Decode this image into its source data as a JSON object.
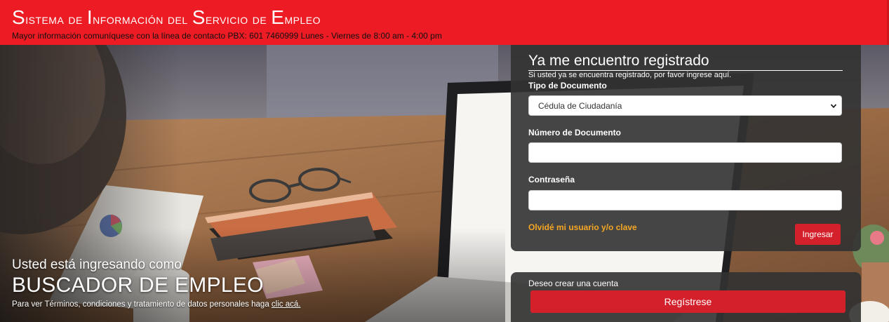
{
  "header": {
    "title_parts": [
      {
        "cap": "S",
        "rest": "istema "
      },
      {
        "cap": "",
        "rest": "de "
      },
      {
        "cap": "I",
        "rest": "nformación "
      },
      {
        "cap": "",
        "rest": "del "
      },
      {
        "cap": "S",
        "rest": "ervicio "
      },
      {
        "cap": "",
        "rest": "de "
      },
      {
        "cap": "E",
        "rest": "mpleo"
      }
    ],
    "contact": "Mayor información comuníquese con la línea de contacto PBX: 601 7460999 Lunes - Viernes de 8:00 am - 4:00 pm",
    "color": "#ed1c24"
  },
  "hero": {
    "subtitle": "Usted está ingresando como",
    "role": "BUSCADOR DE EMPLEO",
    "terms_text": "Para ver Términos, condiciones y tratamiento de datos personales haga ",
    "terms_link": "clic acá."
  },
  "login": {
    "title": "Ya me encuentro registrado",
    "description": "Si usted ya se encuentra registrado, por favor ingrese aquí.",
    "doc_type_label": "Tipo de Documento",
    "doc_type_value": "Cédula de Ciudadanía",
    "doc_number_label": "Número de Documento",
    "doc_number_value": "",
    "password_label": "Contraseña",
    "password_value": "",
    "forgot_link": "Olvidé mi usuario y/o clave",
    "submit_label": "Ingresar",
    "accent_color": "#f5a623",
    "button_color": "#d3202a"
  },
  "register": {
    "label": "Deseo crear una cuenta",
    "button_label": "Regístrese"
  },
  "icons": {
    "select_chevron": "chevron-down-icon"
  }
}
